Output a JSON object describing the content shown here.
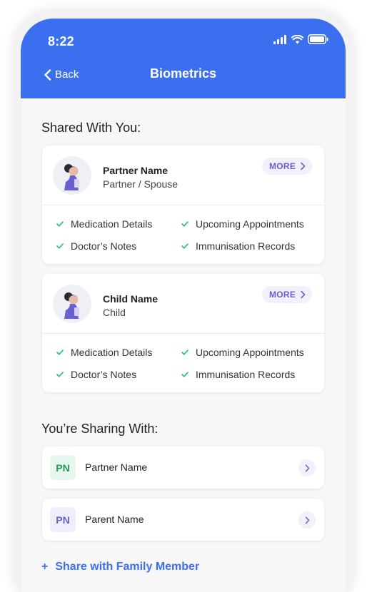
{
  "status_bar": {
    "time": "8:22"
  },
  "nav": {
    "back_label": "Back",
    "title": "Biometrics"
  },
  "shared_with_you": {
    "heading": "Shared With You:",
    "cards": [
      {
        "name": "Partner Name",
        "relation": "Partner / Spouse",
        "more_label": "MORE",
        "permissions": [
          "Medication Details",
          "Upcoming Appointments",
          "Doctor’s Notes",
          "Immunisation Records"
        ]
      },
      {
        "name": "Child Name",
        "relation": "Child",
        "more_label": "MORE",
        "permissions": [
          "Medication Details",
          "Upcoming Appointments",
          "Doctor’s Notes",
          "Immunisation Records"
        ]
      }
    ]
  },
  "sharing_with": {
    "heading": "You’re Sharing With:",
    "rows": [
      {
        "initials": "PN",
        "name": "Partner Name",
        "badge_bg": "#e6f7ee",
        "badge_fg": "#1f9a59"
      },
      {
        "initials": "PN",
        "name": "Parent Name",
        "badge_bg": "#efeefb",
        "badge_fg": "#6a5fd0"
      }
    ]
  },
  "actions": {
    "add_prefix": "+",
    "add_label": "Share with Family Member"
  },
  "colors": {
    "primary": "#3b6ff0",
    "accent_purple": "#6a5fd0",
    "check_green": "#1fbf7a"
  }
}
